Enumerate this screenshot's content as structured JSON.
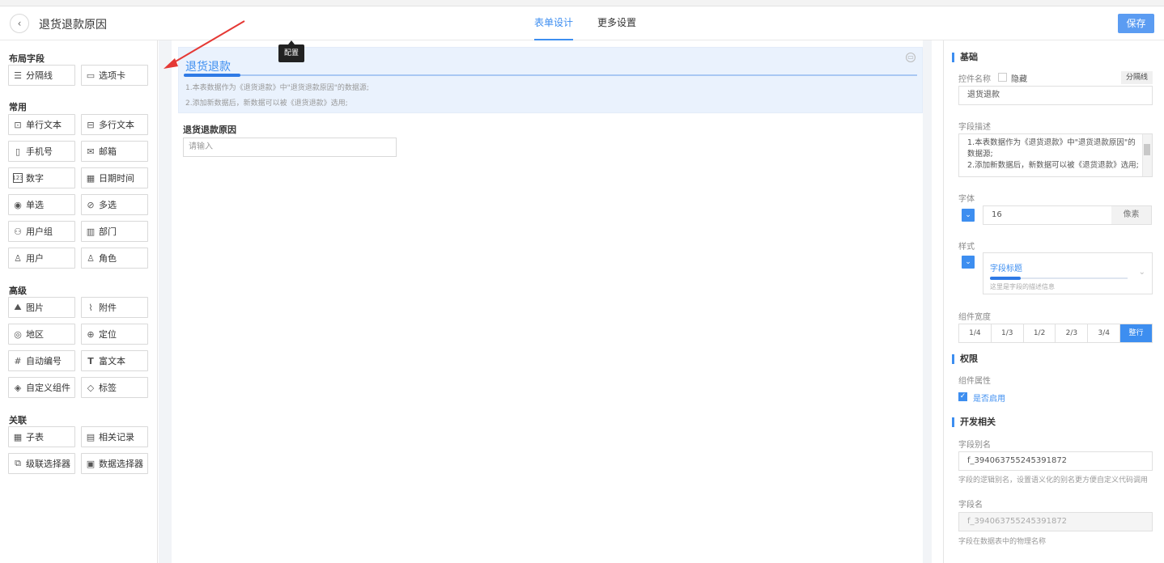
{
  "header": {
    "back_icon": "chevron-left-icon",
    "title": "退货退款原因",
    "tabs": [
      {
        "label": "表单设计",
        "active": true
      },
      {
        "label": "更多设置",
        "active": false
      }
    ],
    "save_label": "保存"
  },
  "left_panel": {
    "groups": [
      {
        "title": "布局字段",
        "items": [
          {
            "label": "分隔线",
            "icon": "divider-icon"
          },
          {
            "label": "选项卡",
            "icon": "tab-icon"
          }
        ]
      },
      {
        "title": "常用",
        "items": [
          {
            "label": "单行文本",
            "icon": "single-line-text-icon"
          },
          {
            "label": "多行文本",
            "icon": "multi-line-text-icon"
          },
          {
            "label": "手机号",
            "icon": "phone-icon"
          },
          {
            "label": "邮箱",
            "icon": "mail-icon"
          },
          {
            "label": "数字",
            "icon": "number-icon"
          },
          {
            "label": "日期时间",
            "icon": "calendar-icon"
          },
          {
            "label": "单选",
            "icon": "radio-icon"
          },
          {
            "label": "多选",
            "icon": "checkbox-icon"
          },
          {
            "label": "用户组",
            "icon": "user-group-icon"
          },
          {
            "label": "部门",
            "icon": "department-icon"
          },
          {
            "label": "用户",
            "icon": "user-icon"
          },
          {
            "label": "角色",
            "icon": "role-icon"
          }
        ]
      },
      {
        "title": "高级",
        "items": [
          {
            "label": "图片",
            "icon": "image-icon"
          },
          {
            "label": "附件",
            "icon": "attachment-icon"
          },
          {
            "label": "地区",
            "icon": "region-icon"
          },
          {
            "label": "定位",
            "icon": "location-icon"
          },
          {
            "label": "自动编号",
            "icon": "hash-icon"
          },
          {
            "label": "富文本",
            "icon": "rich-text-icon"
          },
          {
            "label": "自定义组件",
            "icon": "custom-component-icon"
          },
          {
            "label": "标签",
            "icon": "tag-icon"
          }
        ]
      },
      {
        "title": "关联",
        "items": [
          {
            "label": "子表",
            "icon": "subtable-icon"
          },
          {
            "label": "相关记录",
            "icon": "related-record-icon"
          },
          {
            "label": "级联选择器",
            "icon": "cascader-icon"
          },
          {
            "label": "数据选择器",
            "icon": "data-selector-icon"
          }
        ]
      }
    ]
  },
  "canvas": {
    "tooltip": "配置",
    "section": {
      "title": "退货退款",
      "desc1": "1.本表数据作为《退货退款》中\"退货退款原因\"的数据源;",
      "desc2": "2.添加新数据后，新数据可以被《退货退款》选用;"
    },
    "field": {
      "label": "退货退款原因",
      "placeholder": "请输入"
    }
  },
  "right_panel": {
    "basic": {
      "heading": "基础",
      "name_label": "控件名称",
      "hide_label": "隐藏",
      "type_tag": "分隔线",
      "name_value": "退货退款",
      "desc_label": "字段描述",
      "desc_value": "1.本表数据作为《退货退款》中\"退货退款原因\"的数据源;\n2.添加新数据后，新数据可以被《退货退款》选用;",
      "font_label": "字体",
      "font_size": "16",
      "font_unit": "像素",
      "style_label": "样式",
      "style_preview_title": "字段标题",
      "style_preview_desc": "这里是字段的描述信息",
      "width_label": "组件宽度",
      "width_options": [
        "1/4",
        "1/3",
        "1/2",
        "2/3",
        "3/4",
        "整行"
      ],
      "width_selected": "整行"
    },
    "permission": {
      "heading": "权限",
      "attr_label": "组件属性",
      "enable_label": "是否启用",
      "enabled": true
    },
    "dev": {
      "heading": "开发相关",
      "alias_label": "字段别名",
      "alias_value": "f_394063755245391872",
      "alias_hint": "字段的逻辑别名，设置语义化的别名更方便自定义代码调用",
      "name_label": "字段名",
      "name_value": "f_394063755245391872",
      "name_hint": "字段在数据表中的物理名称"
    }
  },
  "colors": {
    "accent": "#3d8ef0",
    "save_button": "#5b9cf2",
    "section_bg": "#eaf2fd",
    "annotation_arrow": "#e53935"
  }
}
